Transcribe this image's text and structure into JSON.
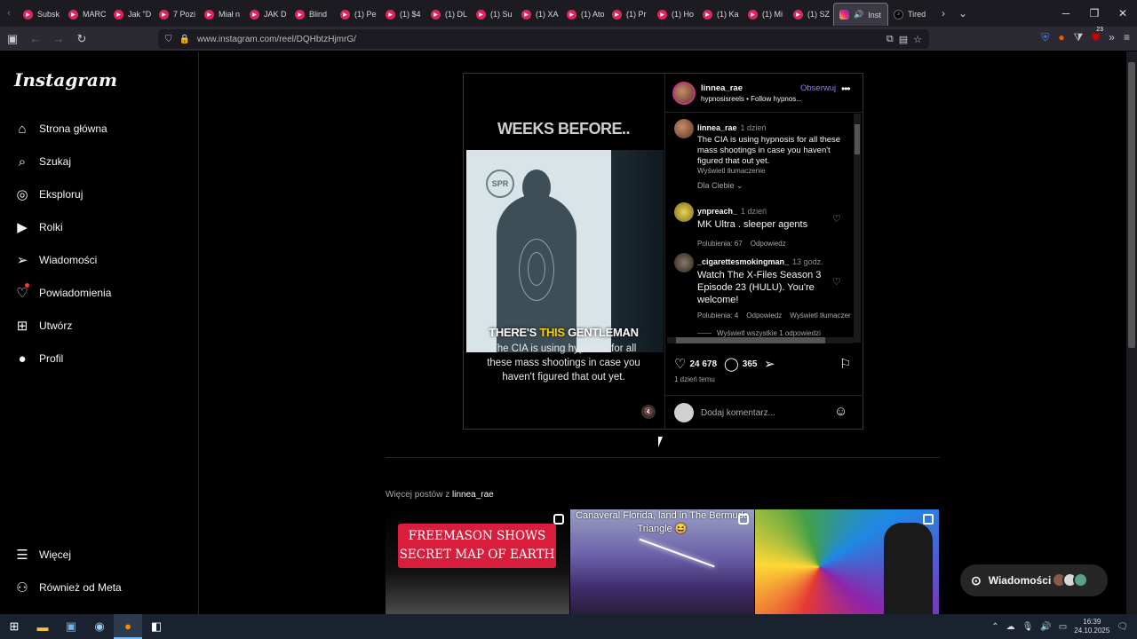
{
  "browser": {
    "tabs": [
      {
        "label": "Subsk",
        "icon": "youtube-icon"
      },
      {
        "label": "MARC",
        "icon": "youtube-icon"
      },
      {
        "label": "Jak \"D",
        "icon": "youtube-icon"
      },
      {
        "label": "7 Pozi",
        "icon": "youtube-icon"
      },
      {
        "label": "Miał n",
        "icon": "youtube-icon"
      },
      {
        "label": "JAK D",
        "icon": "youtube-icon"
      },
      {
        "label": "Blind",
        "icon": "youtube-icon"
      },
      {
        "label": "(1) Pe",
        "icon": "youtube-icon"
      },
      {
        "label": "(1) $4",
        "icon": "youtube-icon"
      },
      {
        "label": "(1) DL",
        "icon": "youtube-icon"
      },
      {
        "label": "(1) Su",
        "icon": "youtube-icon"
      },
      {
        "label": "(1) XA",
        "icon": "youtube-icon"
      },
      {
        "label": "(1) Ato",
        "icon": "youtube-icon"
      },
      {
        "label": "(1) Pr",
        "icon": "youtube-icon"
      },
      {
        "label": "(1) Ho",
        "icon": "youtube-icon"
      },
      {
        "label": "(1) Ka",
        "icon": "youtube-icon"
      },
      {
        "label": "(1) Mi",
        "icon": "youtube-icon"
      },
      {
        "label": "(1) SZ",
        "icon": "youtube-icon"
      }
    ],
    "active_tab": {
      "label": "Inst",
      "icon": "instagram-icon"
    },
    "tiktok_tab": {
      "label": "Tired",
      "icon": "tiktok-icon"
    },
    "url": "www.instagram.com/reel/DQHbtzHjmrG/",
    "extension_badge": "23"
  },
  "sidebar": {
    "logo": "Instagram",
    "items": [
      {
        "label": "Strona główna",
        "icon": "home-icon"
      },
      {
        "label": "Szukaj",
        "icon": "search-icon"
      },
      {
        "label": "Eksploruj",
        "icon": "compass-icon"
      },
      {
        "label": "Rolki",
        "icon": "reels-icon"
      },
      {
        "label": "Wiadomości",
        "icon": "send-icon"
      },
      {
        "label": "Powiadomienia",
        "icon": "heart-icon"
      },
      {
        "label": "Utwórz",
        "icon": "plus-icon"
      },
      {
        "label": "Profil",
        "icon": "avatar-icon"
      }
    ],
    "bottom": [
      {
        "label": "Więcej",
        "icon": "menu-icon"
      },
      {
        "label": "Również od Meta",
        "icon": "meta-icon"
      }
    ]
  },
  "post": {
    "video": {
      "heading": "WEEKS BEFORE..",
      "caption_a": "THERE'S",
      "caption_hl": "THIS",
      "caption_b": "GENTLEMAN",
      "subtitle": "The CIA is using hypnosis for all these mass shootings in case you haven't figured that out yet.",
      "seal_text": "SPR"
    },
    "header": {
      "username": "linnea_rae",
      "follow": "Obserwuj",
      "audio": "hypnosisreels • Follow hypnos..."
    },
    "caption": {
      "username": "linnea_rae",
      "time": "1 dzień",
      "text": "The CIA is using hypnosis for all these mass shootings in case you haven't figured that out yet.",
      "translate": "Wyświetl tłumaczenie"
    },
    "sort": "Dla Ciebie",
    "comments": [
      {
        "username": "ynpreach_",
        "time": "1 dzień",
        "text": "MK Ultra . sleeper agents",
        "likes": "Polubienia: 67",
        "reply": "Odpowiedz"
      },
      {
        "username": "_cigarettesmokingman_",
        "time": "13 godz.",
        "text": "Watch The X-Files Season 3 Episode 23 (HULU). You're welcome!",
        "likes": "Polubienia: 4",
        "reply": "Odpowiedz",
        "translate": "Wyświetl tłumaczer"
      }
    ],
    "view_replies": "Wyświetl wszystkie 1 odpowiedzi",
    "likes_count": "24 678",
    "comments_count": "365",
    "age": "1 dzień temu",
    "comment_placeholder": "Dodaj komentarz..."
  },
  "more_posts": {
    "label": "Więcej postów z",
    "username": "linnea_rae",
    "thumbs": [
      {
        "text": "FREEMASON SHOWS SECRET MAP OF EARTH"
      },
      {
        "text": "Canaveral Florida, land in The Bermuda Triangle 😆"
      },
      {
        "text": ""
      }
    ]
  },
  "messages_pill": "Wiadomości",
  "taskbar": {
    "time": "16:39",
    "date": "24.10.2025"
  },
  "colors": {
    "instagram_bg": "#000000",
    "follow_link": "#8a7cff",
    "tab_bar": "#1c1b22",
    "highlight_text": "#f4d20c",
    "thumb_banner": "#d81e3c"
  }
}
